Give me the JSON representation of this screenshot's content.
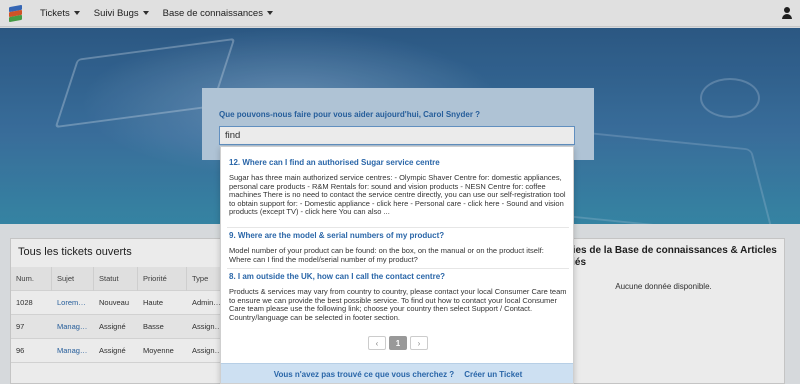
{
  "nav": {
    "items": [
      {
        "label": "Tickets"
      },
      {
        "label": "Suivi Bugs"
      },
      {
        "label": "Base de connaissances"
      }
    ]
  },
  "search": {
    "title": "Que pouvons-nous faire pour vous aider aujourd'hui, Carol Snyder ?",
    "value": "find"
  },
  "tickets_card": {
    "title": "Tous les tickets ouverts",
    "columns": [
      "Num.",
      "Sujet",
      "Statut",
      "Priorité",
      "Type"
    ],
    "rows": [
      [
        "1028",
        "Lorem…",
        "Nouveau",
        "Haute",
        "Admin…"
      ],
      [
        "97",
        "Manag…",
        "Assigné",
        "Basse",
        "Assign…"
      ],
      [
        "96",
        "Manag…",
        "Assigné",
        "Moyenne",
        "Assign…"
      ]
    ]
  },
  "kb_card": {
    "title": "égories de la Base de connaissances & Articles publiés",
    "empty": "Aucune donnée disponible."
  },
  "results": [
    {
      "title": "12. Where can I find an authorised Sugar service centre",
      "body": "Sugar has three main authorized service centres:   -     Olympic Shaver Centre for: domestic appliances, personal care products -     R&M Rentals for: sound and vision products -     NESN Centre for: coffee machines   There is no need to contact the service centre directly, you can use our self-registration tool to obtain support for:   -     Domestic appliance - click here -     Personal care - click here -     Sound and vision products (except TV) - click here   You can also ..."
    },
    {
      "title": "9. Where are the model & serial numbers of my product?",
      "body": "Model number of your product can be found: on the box, on the manual or on the product itself:     Where can I find the model/serial number of my product?"
    },
    {
      "title": "8. I am outside the UK, how can I call the contact centre?",
      "body": "Products & services may vary from country to country, please contact your local Consumer Care team to ensure we can provide the best possible service.  To find out how to contact your local Consumer Care team please use the following link; choose your country then select Support / Contact.   Country/language can be selected in footer section."
    }
  ],
  "pager": {
    "prev": "‹",
    "current": "1",
    "next": "›"
  },
  "footer": {
    "question": "Vous n'avez pas trouvé ce que vous cherchez ?",
    "cta": "Créer un Ticket"
  }
}
